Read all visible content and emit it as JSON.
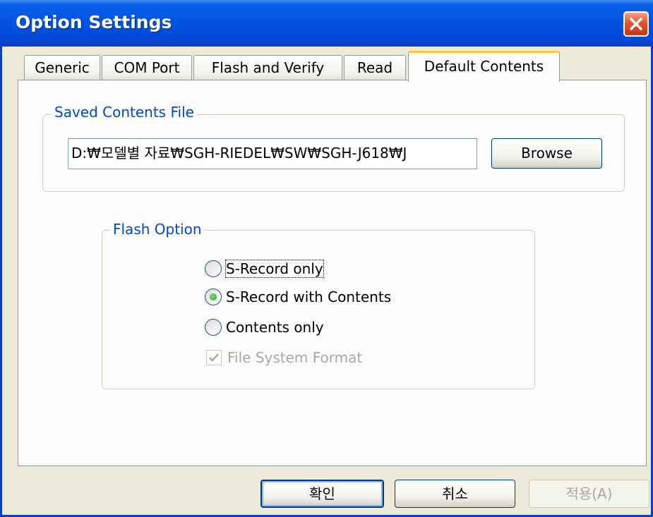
{
  "window": {
    "title": "Option Settings"
  },
  "tabs": [
    {
      "label": "Generic"
    },
    {
      "label": "COM Port"
    },
    {
      "label": "Flash and Verify"
    },
    {
      "label": "Read"
    },
    {
      "label": "Default Contents"
    }
  ],
  "saved_contents": {
    "group_label": "Saved Contents File",
    "path_value": "D:₩모델별 자료₩SGH-RIEDEL₩SW₩SGH-J618₩J",
    "browse_label": "Browse"
  },
  "flash_option": {
    "group_label": "Flash Option",
    "options": [
      {
        "label": "S-Record only",
        "selected": false
      },
      {
        "label": "S-Record with Contents",
        "selected": true
      },
      {
        "label": "Contents only",
        "selected": false
      }
    ],
    "checkbox": {
      "label": "File System Format",
      "checked": true,
      "enabled": false
    }
  },
  "footer": {
    "ok_label": "확인",
    "cancel_label": "취소",
    "apply_label": "적용(A)"
  }
}
